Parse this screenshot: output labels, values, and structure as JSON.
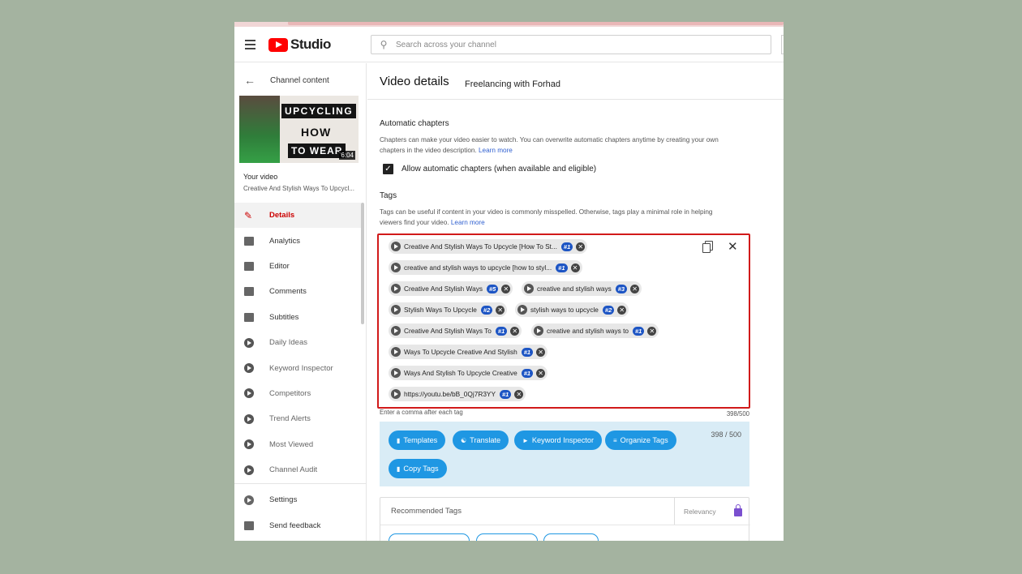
{
  "header": {
    "logo_text": "Studio",
    "search_placeholder": "Search across your channel"
  },
  "sidebar": {
    "back_label": "Channel content",
    "thumbnail": {
      "line1": "UPCYCLING",
      "line2": "HOW",
      "line3": "TO WEAR",
      "duration": "6:04"
    },
    "your_video_label": "Your video",
    "video_title": "Creative And Stylish Ways To Upcycl...",
    "items": [
      {
        "label": "Details",
        "icon": "pencil-icon",
        "active": true
      },
      {
        "label": "Analytics",
        "icon": "analytics-icon"
      },
      {
        "label": "Editor",
        "icon": "editor-icon"
      },
      {
        "label": "Comments",
        "icon": "comments-icon"
      },
      {
        "label": "Subtitles",
        "icon": "subtitles-icon"
      },
      {
        "label": "Daily Ideas",
        "icon": "vidiq-icon"
      },
      {
        "label": "Keyword Inspector",
        "icon": "vidiq-icon"
      },
      {
        "label": "Competitors",
        "icon": "vidiq-icon"
      },
      {
        "label": "Trend Alerts",
        "icon": "vidiq-icon"
      },
      {
        "label": "Most Viewed",
        "icon": "vidiq-icon"
      },
      {
        "label": "Channel Audit",
        "icon": "vidiq-icon"
      }
    ],
    "bottom_items": [
      {
        "label": "Settings",
        "icon": "gear-icon"
      },
      {
        "label": "Send feedback",
        "icon": "feedback-icon"
      }
    ]
  },
  "main": {
    "page_title": "Video details",
    "channel_name": "Freelancing with Forhad",
    "chapters": {
      "heading": "Automatic chapters",
      "description": "Chapters can make your video easier to watch. You can overwrite automatic chapters anytime by creating your own chapters in the video description.",
      "learn_more": "Learn more",
      "checkbox_label": "Allow automatic chapters (when available and eligible)"
    },
    "tags": {
      "heading": "Tags",
      "description": "Tags can be useful if content in your video is commonly misspelled. Otherwise, tags play a minimal role in helping viewers find your video.",
      "learn_more": "Learn more",
      "chips": [
        {
          "text": "Creative And Stylish Ways To Upcycle [How To St...",
          "rank": "#1"
        },
        {
          "text": "creative and stylish ways to upcycle [how to styl...",
          "rank": "#1"
        },
        {
          "text": "Creative And Stylish Ways",
          "rank": "#5"
        },
        {
          "text": "creative and stylish ways",
          "rank": "#3"
        },
        {
          "text": "Stylish Ways To Upcycle",
          "rank": "#2"
        },
        {
          "text": "stylish ways to upcycle",
          "rank": "#2"
        },
        {
          "text": "Creative And Stylish Ways To",
          "rank": "#1"
        },
        {
          "text": "creative and stylish ways to",
          "rank": "#1"
        },
        {
          "text": "Ways To Upcycle Creative And Stylish",
          "rank": "#1"
        },
        {
          "text": "Ways And Stylish To Upcycle Creative",
          "rank": "#1"
        },
        {
          "text": "https://youtu.be/bB_0Qj7R3YY",
          "rank": "#1"
        }
      ],
      "hint": "Enter a comma after each tag",
      "count": "398/500"
    },
    "tools": {
      "buttons": [
        "Templates",
        "Translate",
        "Keyword Inspector",
        "Organize Tags",
        "Copy Tags"
      ],
      "count": "398 / 500"
    },
    "recommended": {
      "title": "Recommended Tags",
      "relevancy_label": "Relevancy"
    }
  },
  "colors": {
    "accent_red": "#cc0000",
    "tag_box_border": "#d11a1a",
    "tool_button": "#1f97e3",
    "rank_badge": "#1d55c4",
    "tool_panel_bg": "#d9ecf6"
  }
}
